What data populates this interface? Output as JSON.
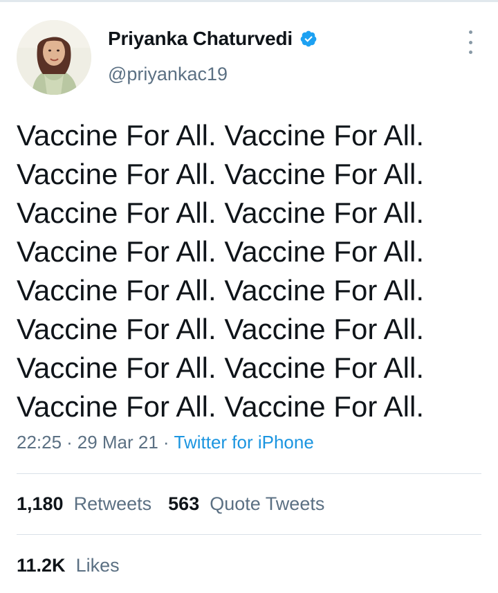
{
  "author": {
    "name": "Priyanka Chaturvedi",
    "handle": "@priyankac19",
    "verified": true,
    "avatar_icon": "profile-photo"
  },
  "tweet": {
    "lines": [
      "Vaccine For All. Vaccine For All.",
      "Vaccine For All. Vaccine For All.",
      "Vaccine For All. Vaccine For All.",
      "Vaccine For All. Vaccine For All.",
      "Vaccine For All. Vaccine For All.",
      "Vaccine For All. Vaccine For All.",
      "Vaccine For All. Vaccine For All.",
      "Vaccine For All. Vaccine For All."
    ],
    "time": "22:25",
    "date": "29 Mar 21",
    "separator": "·",
    "source": "Twitter for iPhone"
  },
  "stats": {
    "retweets_count": "1,180",
    "retweets_label": "Retweets",
    "quotes_count": "563",
    "quotes_label": "Quote Tweets",
    "likes_count": "11.2K",
    "likes_label": "Likes"
  },
  "colors": {
    "text": "#0f1419",
    "secondary": "#5b7083",
    "link": "#1b95e0",
    "verified": "#1da1f2",
    "divider": "#d9e1e8"
  },
  "icons": {
    "verified": "verified-badge-icon",
    "more": "more-vertical-icon"
  }
}
